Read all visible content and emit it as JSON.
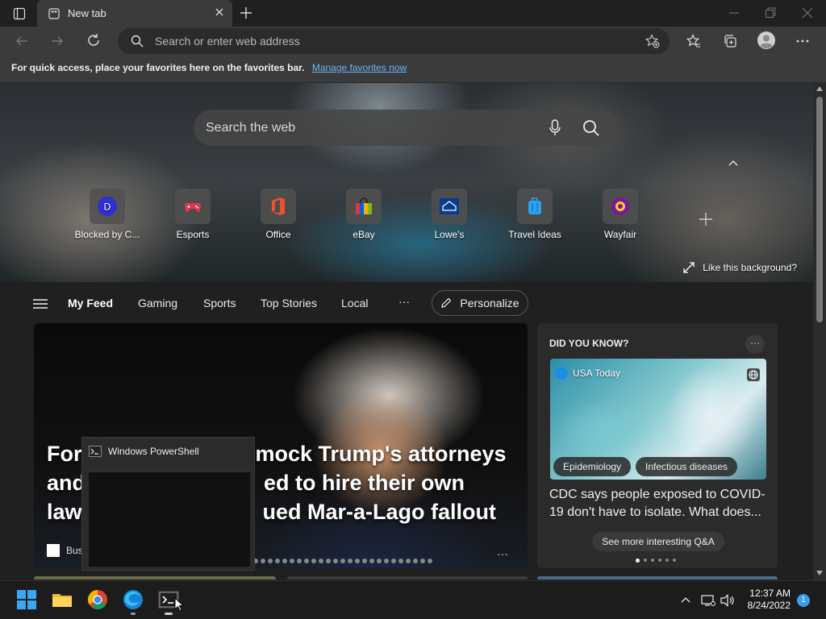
{
  "browser": {
    "tab_title": "New tab",
    "address_placeholder": "Search or enter web address"
  },
  "favbar": {
    "message": "For quick access, place your favorites here on the favorites bar.",
    "link": "Manage favorites now"
  },
  "hero": {
    "search_placeholder": "Search the web",
    "tiles": [
      {
        "label": "Blocked by C...",
        "letter": "D"
      },
      {
        "label": "Esports"
      },
      {
        "label": "Office"
      },
      {
        "label": "eBay"
      },
      {
        "label": "Lowe's"
      },
      {
        "label": "Travel Ideas"
      },
      {
        "label": "Wayfair"
      }
    ],
    "like_bg": "Like this background?"
  },
  "feed_nav": {
    "items": [
      "My Feed",
      "Gaming",
      "Sports",
      "Top Stories",
      "Local"
    ],
    "more": "···",
    "personalize": "Personalize"
  },
  "main_story": {
    "headline": "For... mock Trump's attorneys and... ed to hire their own law... ued Mar-a-Lago fallout",
    "headline_lines": [
      "For",
      "mock Trump's attorneys",
      "and",
      "ed to hire their own",
      "law",
      "ued Mar-a-Lago fallout"
    ],
    "source": "Bus",
    "more": "···"
  },
  "powershell_preview": {
    "title": "Windows PowerShell"
  },
  "did_you_know": {
    "title": "DID YOU KNOW?",
    "more": "···",
    "source": "USA Today",
    "tags": [
      "Epidemiology",
      "Infectious diseases"
    ],
    "question": "CDC says people exposed to COVID-19 don't have to isolate. What does...",
    "see_more": "See more interesting Q&A"
  },
  "taskbar": {
    "time": "12:37 AM",
    "date": "8/24/2022",
    "notification_count": "1"
  },
  "colors": {
    "accent_link": "#6ab4f8",
    "taskbar_badge": "#3a9df0"
  }
}
